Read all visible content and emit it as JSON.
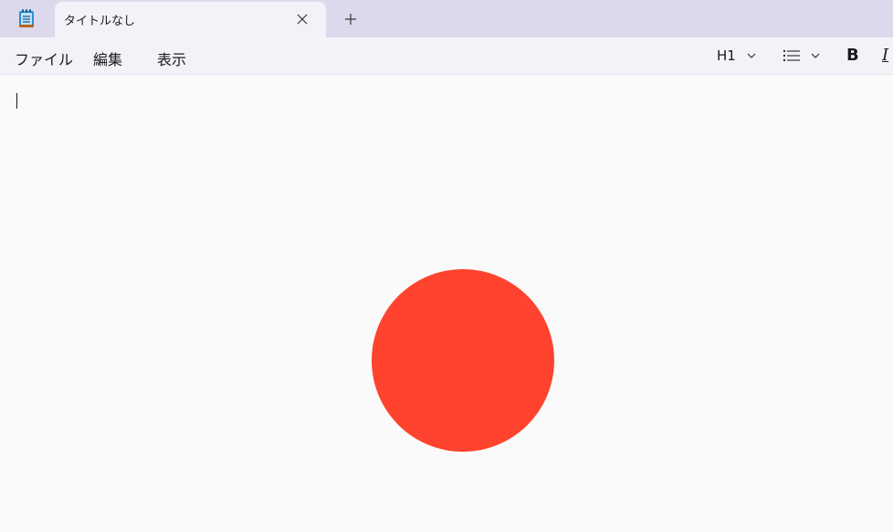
{
  "tab": {
    "title": "タイトルなし"
  },
  "menu": {
    "file": "ファイル",
    "edit": "編集",
    "view": "表示"
  },
  "toolbar": {
    "heading": "H1",
    "bold": "B",
    "italic": "I"
  },
  "icons": {
    "app": "notepad-icon",
    "close": "close-icon",
    "add": "plus-icon",
    "list": "list-icon",
    "chevron": "chevron-down-icon"
  },
  "colors": {
    "circle": "#ff432e",
    "tabbar": "#dcd9ec",
    "active_tab": "#f3f2f8"
  }
}
